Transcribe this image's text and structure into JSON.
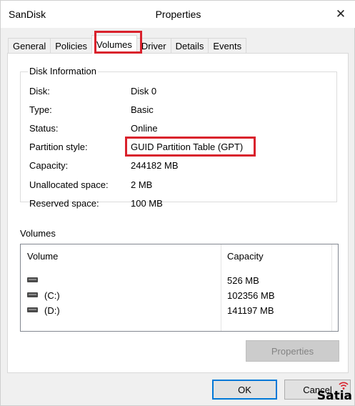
{
  "window": {
    "app_name": "SanDisk",
    "title": "Properties",
    "close_glyph": "✕"
  },
  "tabs": [
    {
      "label": "General",
      "active": false
    },
    {
      "label": "Policies",
      "active": false
    },
    {
      "label": "Volumes",
      "active": true
    },
    {
      "label": "Driver",
      "active": false
    },
    {
      "label": "Details",
      "active": false
    },
    {
      "label": "Events",
      "active": false
    }
  ],
  "disk_info": {
    "group_title": "Disk Information",
    "rows": [
      {
        "label": "Disk:",
        "value": "Disk 0"
      },
      {
        "label": "Type:",
        "value": "Basic"
      },
      {
        "label": "Status:",
        "value": "Online"
      },
      {
        "label": "Partition style:",
        "value": "GUID Partition Table (GPT)"
      },
      {
        "label": "Capacity:",
        "value": "244182 MB"
      },
      {
        "label": "Unallocated space:",
        "value": "2 MB"
      },
      {
        "label": "Reserved space:",
        "value": "100 MB"
      }
    ]
  },
  "volumes": {
    "section_label": "Volumes",
    "columns": [
      "Volume",
      "Capacity"
    ],
    "rows": [
      {
        "name": "",
        "capacity": "526 MB",
        "icon": "drive-icon"
      },
      {
        "name": "(C:)",
        "capacity": "102356 MB",
        "icon": "drive-icon"
      },
      {
        "name": "(D:)",
        "capacity": "141197 MB",
        "icon": "drive-icon"
      }
    ],
    "properties_button": "Properties"
  },
  "buttons": {
    "ok": "OK",
    "cancel": "Cancel"
  },
  "watermark": "Satia",
  "colors": {
    "highlight": "#d9212c",
    "focus": "#0078d7"
  }
}
